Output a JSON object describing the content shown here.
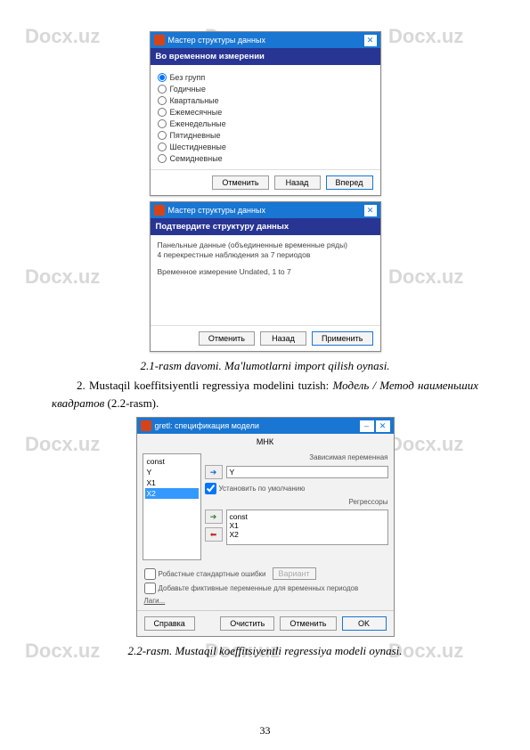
{
  "watermark": "Docx.uz",
  "dialog1": {
    "title": "Мастер структуры данных",
    "banner": "Во временном измерении",
    "options": [
      "Без групп",
      "Годичные",
      "Квартальные",
      "Ежемесячные",
      "Еженедельные",
      "Пятидневные",
      "Шестидневные",
      "Семидневные"
    ],
    "selected": 0,
    "buttons": {
      "cancel": "Отменить",
      "back": "Назад",
      "forward": "Вперед"
    }
  },
  "dialog2": {
    "title": "Мастер структуры данных",
    "banner": "Подтвердите структуру данных",
    "line1": "Панельные данные (объединенные временные ряды)",
    "line2": "4 перекрестные наблюдения за 7 периодов",
    "line3": "Временное измерение Undated, 1 to 7",
    "buttons": {
      "cancel": "Отменить",
      "back": "Назад",
      "apply": "Применить"
    }
  },
  "caption1": "2.1-rasm davomi. Ma'lumotlarni import qilish oynasi.",
  "para2": {
    "prefix": "2. Mustaqil koeffitsiyentli regressiya modelini tuzish: ",
    "italic": "Модель / Метод наименьших квадратов",
    "suffix": " (2.2-rasm)."
  },
  "dialog3": {
    "title": "gretl: спецификация модели",
    "mhk": "МНК",
    "left_items": [
      "const",
      "Y",
      "X1",
      "X2"
    ],
    "left_selected": 3,
    "dep_label": "Зависимая переменная",
    "dep_value": "Y",
    "default_chk": "Установить по умолчанию",
    "reg_label": "Регрессоры",
    "reg_items": "const\nX1\nX2",
    "robust_chk": "Робастные стандартные ошибки",
    "robust_btn": "Вариант",
    "fixed_chk": "Добавьте фиктивные переменные для временных периодов",
    "lags": "Лаги...",
    "buttons": {
      "help": "Справка",
      "clear": "Очистить",
      "cancel": "Отменить",
      "ok": "OK"
    }
  },
  "caption2": "2.2-rasm. Mustaqil koeffitsiyentli regressiya modeli oynasi.",
  "page_number": "33"
}
